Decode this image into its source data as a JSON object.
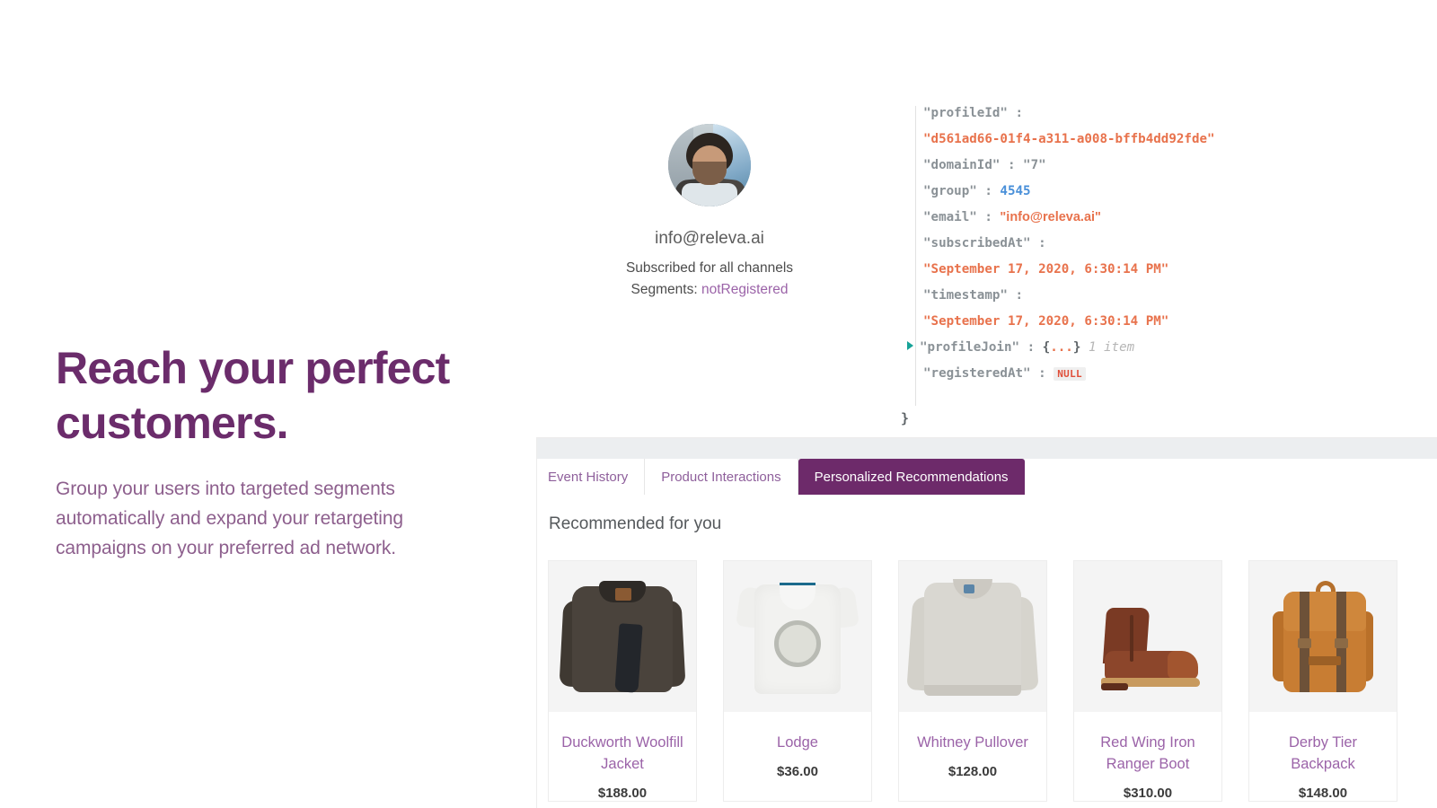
{
  "marketing": {
    "headline": "Reach your perfect customers.",
    "subcopy": "Group your users into targeted segments automatically and expand your retargeting campaigns on your preferred ad network."
  },
  "profile": {
    "avatar_icon": "user-avatar-photo",
    "email": "info@releva.ai",
    "subscription_status": "Subscribed for all channels",
    "segments_label": "Segments:",
    "segments_value": "notRegistered"
  },
  "json_viewer": {
    "disclosure_icon": "expand-triangle-icon",
    "closing_brace": "}",
    "rows": [
      {
        "key": "\"profileId\"",
        "sep": " : ",
        "value": "\"d561ad66-01f4-a311-a008-bffb4dd92fde\"",
        "type": "string"
      },
      {
        "key": "\"domainId\"",
        "sep": " : ",
        "value": "\"7\"",
        "type": "key"
      },
      {
        "key": "\"group\"",
        "sep": " : ",
        "value": "4545",
        "type": "number"
      },
      {
        "key": "\"email\"",
        "sep": " : ",
        "value": "\"info@releva.ai\"",
        "type": "email"
      },
      {
        "key": "\"subscribedAt\"",
        "sep": " : ",
        "value": "\"September 17, 2020, 6:30:14 PM\"",
        "type": "string"
      },
      {
        "key": "\"timestamp\"",
        "sep": " : ",
        "value": "\"September 17, 2020, 6:30:14 PM\"",
        "type": "string"
      },
      {
        "key": "\"profileJoin\"",
        "sep": " : ",
        "value": "{...}",
        "meta": "1 item",
        "type": "object"
      },
      {
        "key": "\"registeredAt\"",
        "sep": " : ",
        "value": "NULL",
        "type": "null"
      }
    ]
  },
  "app_panel": {
    "tabs": [
      {
        "label": "Event History",
        "active": false
      },
      {
        "label": "Product Interactions",
        "active": false
      },
      {
        "label": "Personalized Recommendations",
        "active": true
      }
    ],
    "section_title": "Recommended for you",
    "products": [
      {
        "name": "Duckworth Woolfill Jacket",
        "price": "$188.00",
        "art": "jacket"
      },
      {
        "name": "Lodge",
        "price": "$36.00",
        "art": "tshirt"
      },
      {
        "name": "Whitney Pullover",
        "price": "$128.00",
        "art": "sweater"
      },
      {
        "name": "Red Wing Iron Ranger Boot",
        "price": "$310.00",
        "art": "boot"
      },
      {
        "name": "Derby Tier Backpack",
        "price": "$148.00",
        "art": "backpack"
      }
    ]
  },
  "colors": {
    "brand_purple": "#6b2c6b",
    "tab_active_bg": "#6d2a6a",
    "product_name": "#9b63a8",
    "json_string": "#e8724c",
    "json_number": "#4a90d9",
    "json_key": "#8a9196",
    "null_badge": "#e04e39",
    "panel_topbar": "#eceef0"
  }
}
